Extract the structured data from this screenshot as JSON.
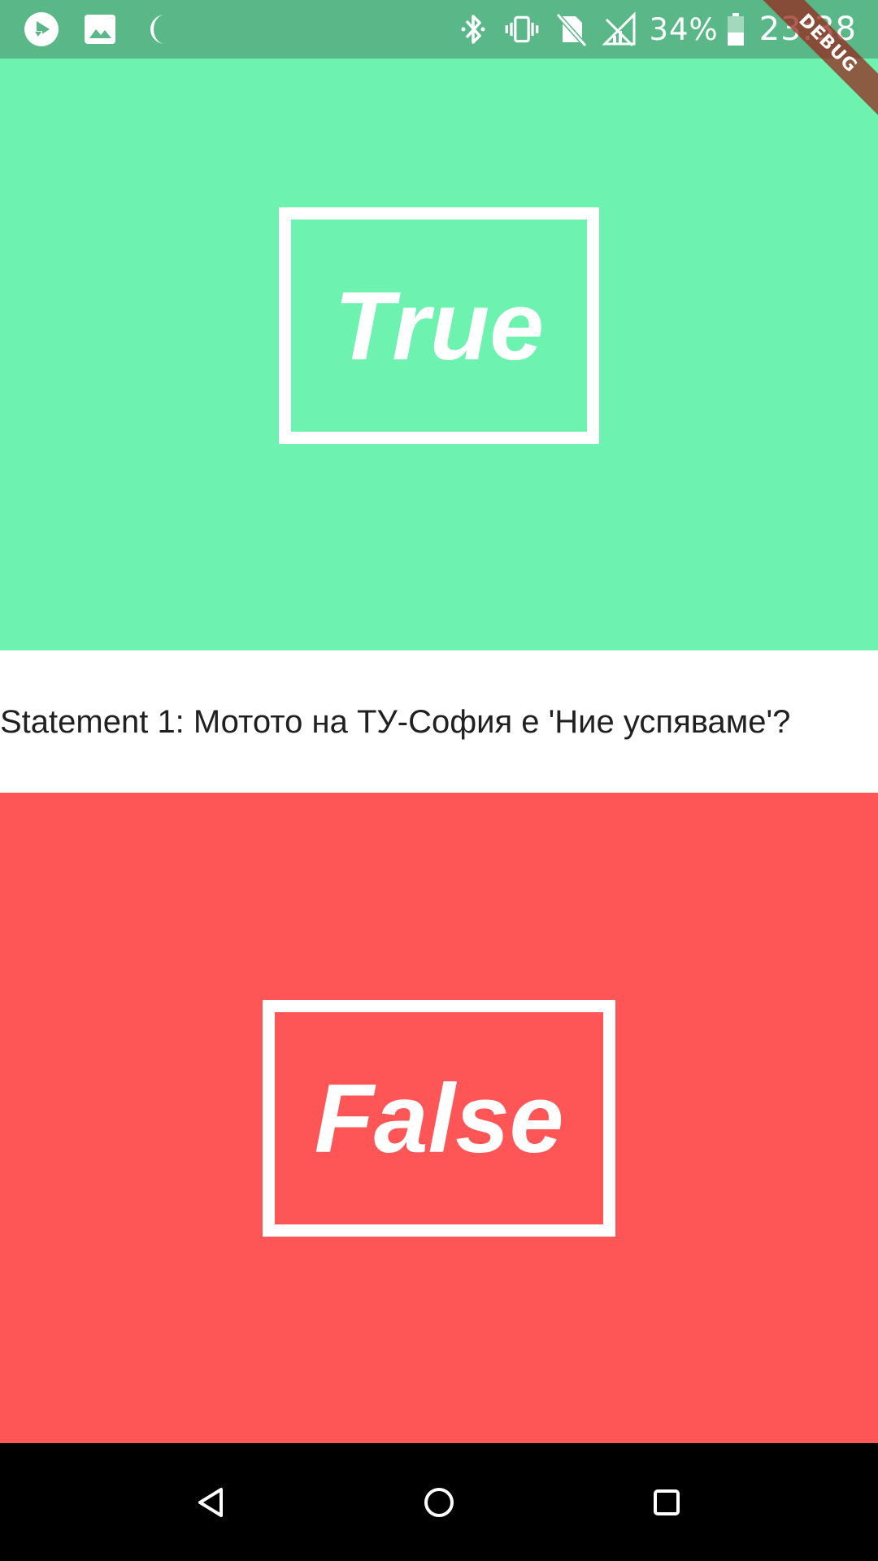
{
  "status_bar": {
    "battery_percent": "34%",
    "time": "23:38",
    "left_icons": [
      "play-store-download-icon",
      "image-icon",
      "moon-icon"
    ],
    "right_icons": [
      "bluetooth-icon",
      "vibrate-icon",
      "no-sim-icon",
      "signal-off-icon",
      "battery-icon"
    ],
    "background_color": "#5ab888"
  },
  "debug_banner": {
    "label": "DEBUG"
  },
  "quiz": {
    "true_label": "True",
    "false_label": "False",
    "statement": "Statement 1: Мотото на ТУ-София е 'Ние успяваме'?",
    "true_color": "#6ef2b0",
    "false_color": "#fe5556"
  },
  "nav_bar": {
    "buttons": [
      "back-icon",
      "home-icon",
      "recents-icon"
    ]
  }
}
